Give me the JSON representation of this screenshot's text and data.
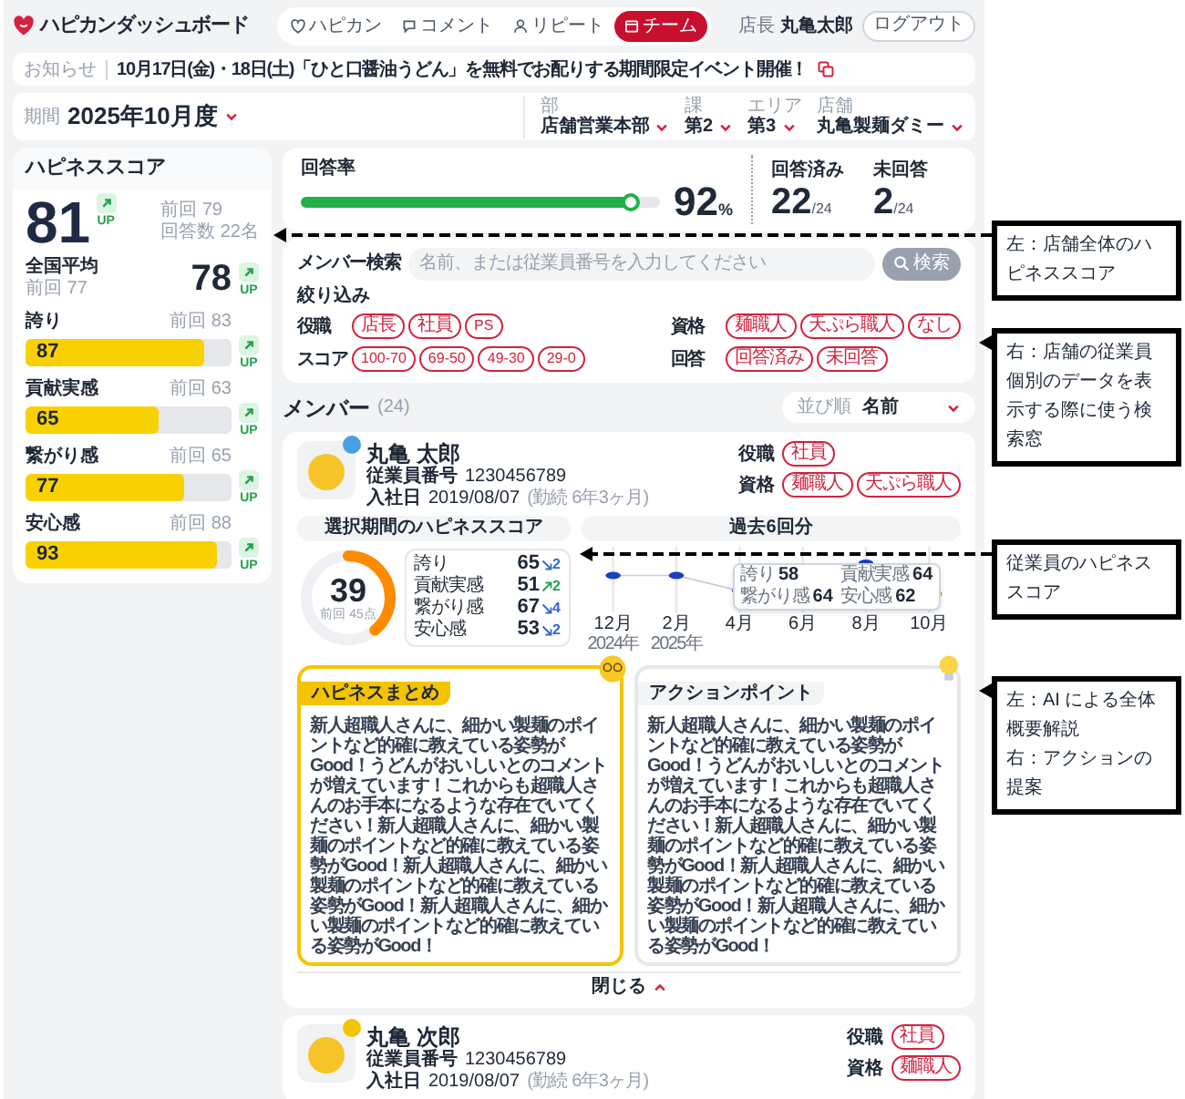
{
  "header": {
    "logo": "ハピカンダッシュボード",
    "nav": [
      {
        "label": "ハピカン",
        "kind": "heart",
        "selected": false
      },
      {
        "label": "コメント",
        "kind": "chat",
        "selected": false
      },
      {
        "label": "リピート",
        "kind": "person",
        "selected": false
      },
      {
        "label": "チーム",
        "kind": "calendar",
        "selected": true
      }
    ],
    "role": "店長",
    "user": "丸亀太郎",
    "logout": "ログアウト"
  },
  "notice": {
    "label": "お知らせ",
    "text": "10月17日(金)・18日(土)「ひと口醤油うどん」を無料でお配りする期間限定イベント開催！"
  },
  "period": {
    "label": "期間",
    "value": "2025年10月度",
    "filters": [
      {
        "label": "部",
        "value": "店舗営業本部"
      },
      {
        "label": "課",
        "value": "第2"
      },
      {
        "label": "エリア",
        "value": "第3"
      },
      {
        "label": "店舗",
        "value": "丸亀製麺ダミー"
      }
    ]
  },
  "happiness": {
    "title": "ハピネススコア",
    "score": "81",
    "trend": {
      "up": true,
      "label": "UP"
    },
    "previous": "前回 79",
    "responses": "回答数 22名",
    "national_label": "全国平均",
    "national_previous": "前回 77",
    "national_score": "78",
    "national_trend": {
      "up": true,
      "label": "UP"
    },
    "metrics": [
      {
        "name": "誇り",
        "previous": "前回 83",
        "value": "87",
        "level": 0.87,
        "trend": {
          "up": true,
          "label": "UP"
        }
      },
      {
        "name": "貢献実感",
        "previous": "前回 63",
        "value": "65",
        "level": 0.65,
        "trend": {
          "up": true,
          "label": "UP"
        }
      },
      {
        "name": "繋がり感",
        "previous": "前回 65",
        "value": "77",
        "level": 0.77,
        "trend": {
          "up": true,
          "label": "UP"
        }
      },
      {
        "name": "安心感",
        "previous": "前回 88",
        "value": "93",
        "level": 0.93,
        "trend": {
          "up": true,
          "label": "UP"
        }
      }
    ]
  },
  "response": {
    "rate_label": "回答率",
    "level": 0.92,
    "rate": "92",
    "rate_unit": "%",
    "answered_label": "回答済み",
    "answered": "22",
    "answered_total": "/24",
    "unanswered_label": "未回答",
    "unanswered": "2",
    "unanswered_total": "/24"
  },
  "search": {
    "label": "メンバー検索",
    "placeholder": "名前、または従業員番号を入力してください",
    "button": "検索",
    "filter_title": "絞り込み",
    "groups": [
      {
        "label": "役職",
        "chips": [
          "店長",
          "社員",
          "PS"
        ]
      },
      {
        "label": "資格",
        "chips": [
          "麺職人",
          "天ぷら職人",
          "なし"
        ]
      },
      {
        "label": "スコア",
        "chips": [
          "100-70",
          "69-50",
          "49-30",
          "29-0"
        ]
      },
      {
        "label": "回答",
        "chips": [
          "回答済み",
          "未回答"
        ]
      }
    ]
  },
  "members_section": {
    "title": "メンバー",
    "count": "(24)",
    "sort_label": "並び順",
    "sort_value": "名前"
  },
  "members": [
    {
      "name": "丸亀 太郎",
      "color": "#4a9fe0",
      "id_label": "従業員番号",
      "id": "1230456789",
      "join_label": "入社日",
      "join_date": "2019/08/07",
      "tenure": "(勤続 6年3ヶ月)",
      "role_label": "役職",
      "roles": [
        "社員"
      ],
      "qual_label": "資格",
      "quals": [
        "麺職人",
        "天ぷら職人"
      ],
      "details": {
        "score_label": "選択期間のハピネススコア",
        "history_label": "過去6回分",
        "score": "39",
        "level": 0.39,
        "score_caption": "前回 45点",
        "sub_scores": [
          {
            "name": "誇り",
            "value": "65",
            "up": false,
            "delta": "2"
          },
          {
            "name": "貢献実感",
            "value": "51",
            "up": true,
            "delta": "2"
          },
          {
            "name": "繋がり感",
            "value": "67",
            "up": false,
            "delta": "4"
          },
          {
            "name": "安心感",
            "value": "53",
            "up": false,
            "delta": "2"
          }
        ],
        "x_labels": [
          {
            "month": "12月",
            "year": "2024年"
          },
          {
            "month": "2月",
            "year": "2025年"
          },
          {
            "month": "4月"
          },
          {
            "month": "6月"
          },
          {
            "month": "8月"
          },
          {
            "month": "10月"
          }
        ],
        "tooltip": [
          {
            "name": "誇り",
            "value": "58"
          },
          {
            "name": "貢献実感",
            "value": "64"
          },
          {
            "name": "繋がり感",
            "value": "64"
          },
          {
            "name": "安心感",
            "value": "62"
          }
        ],
        "panels": [
          {
            "kind": "summary",
            "title": "ハピネスまとめ",
            "text": "新人超職人さんに、細かい製麺のポイントなど的確に教えている姿勢がGood！うどんがおいしいとのコメントが増えています！これからも超職人さんのお手本になるような存在でいてください！新人超職人さんに、細かい製麺のポイントなど的確に教えている姿勢がGood！新人超職人さんに、細かい製麺のポイントなど的確に教えている姿勢がGood！新人超職人さんに、細かい製麺のポイントなど的確に教えている姿勢がGood！"
          },
          {
            "kind": "action",
            "title": "アクションポイント",
            "text": "新人超職人さんに、細かい製麺のポイントなど的確に教えている姿勢がGood！うどんがおいしいとのコメントが増えています！これからも超職人さんのお手本になるような存在でいてください！新人超職人さんに、細かい製麺のポイントなど的確に教えている姿勢がGood！新人超職人さんに、細かい製麺のポイントなど的確に教えている姿勢がGood！新人超職人さんに、細かい製麺のポイントなど的確に教えている姿勢がGood！"
          }
        ],
        "close": "閉じる"
      }
    },
    {
      "name": "丸亀 次郎",
      "color": "#f5c400",
      "id_label": "従業員番号",
      "id": "1230456789",
      "join_label": "入社日",
      "join_date": "2019/08/07",
      "tenure": "(勤続 6年3ヶ月)",
      "role_label": "役職",
      "roles": [
        "社員"
      ],
      "qual_label": "資格",
      "quals": [
        "麺職人"
      ]
    }
  ],
  "annotations": [
    {
      "lines": [
        "左：店舗全体のハピネススコア"
      ]
    },
    {
      "lines": [
        "右：店舗の従業員個別のデータを表示する際に使う検索窓"
      ]
    },
    {
      "lines": [
        "従業員のハピネススコア"
      ]
    },
    {
      "lines": [
        "左：AI による全体概要解説",
        "右：アクションの提案"
      ]
    }
  ]
}
